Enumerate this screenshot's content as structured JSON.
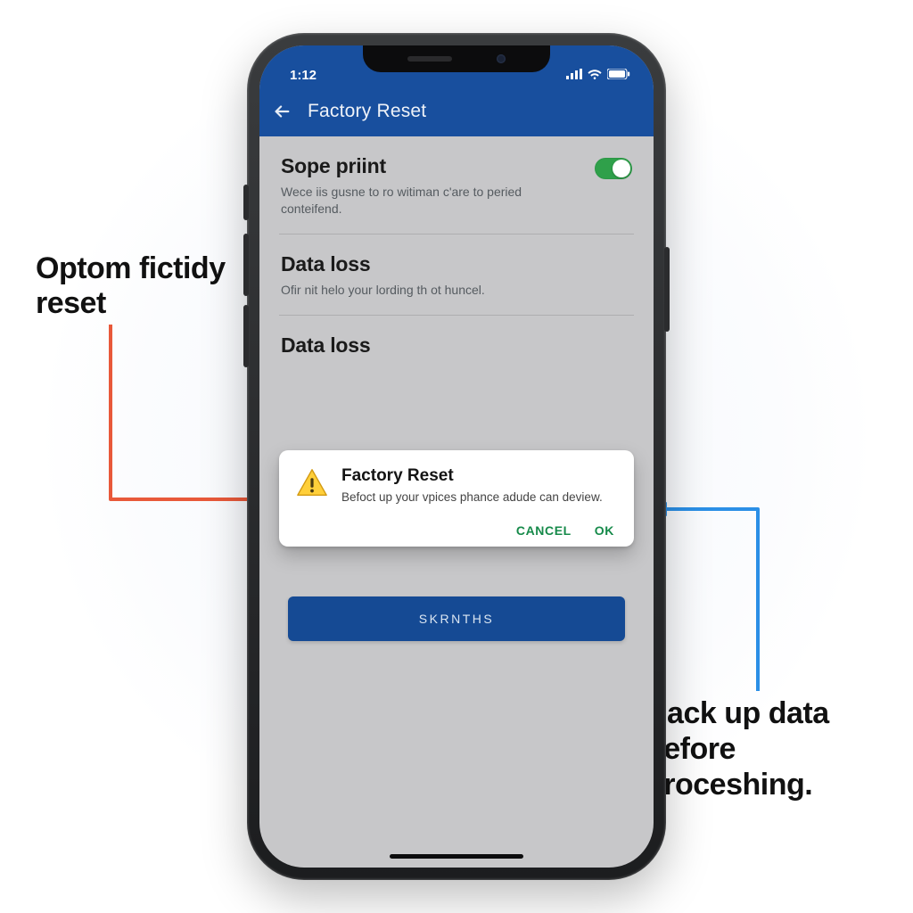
{
  "callouts": {
    "left": "Optom fictidy reset",
    "right": "Back up data before proceshing."
  },
  "status": {
    "time": "1:12"
  },
  "appbar": {
    "title": "Factory Reset"
  },
  "sections": [
    {
      "title": "Sope priint",
      "subtitle": "Wece iis gusne to ro witiman c'are to peried conteifend.",
      "toggle": true
    },
    {
      "title": "Data loss",
      "subtitle": "Ofir nit helo your lording th ot huncel."
    },
    {
      "title": "Data loss",
      "subtitle": ""
    }
  ],
  "dialog": {
    "title": "Factory Reset",
    "message": "Befoct up your vpices phance adude can deview.",
    "cancel": "CANCEL",
    "ok": "OK"
  },
  "primary_button": "SKRNTHS",
  "colors": {
    "appbar": "#184f9e",
    "primary_button": "#154a94",
    "toggle_on": "#2fa04a",
    "dialog_action": "#168a4a",
    "arrow_left": "#e8593a",
    "arrow_right": "#2b8fe6"
  }
}
